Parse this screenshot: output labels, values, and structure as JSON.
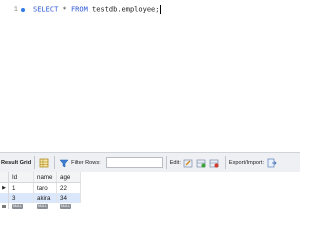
{
  "editor": {
    "line_number": "1",
    "tokens": {
      "select": "SELECT",
      "star": "*",
      "from": "FROM",
      "table": "testdb.employee;"
    }
  },
  "toolbar": {
    "title": "Result Grid",
    "filter_label": "Filter Rows:",
    "filter_value": "",
    "edit_label": "Edit:",
    "export_label": "Export/Import:"
  },
  "grid": {
    "columns": [
      "Id",
      "name",
      "age"
    ],
    "rows": [
      {
        "id": "1",
        "name": "taro",
        "age": "22"
      },
      {
        "id": "3",
        "name": "akira",
        "age": "34"
      }
    ],
    "null_label": "NULL",
    "current_row_marker": "▶"
  },
  "colors": {
    "keyword": "#2b57d6",
    "selected_row": "#dbe8fb",
    "toolbar_bg": "#eef0f3"
  }
}
